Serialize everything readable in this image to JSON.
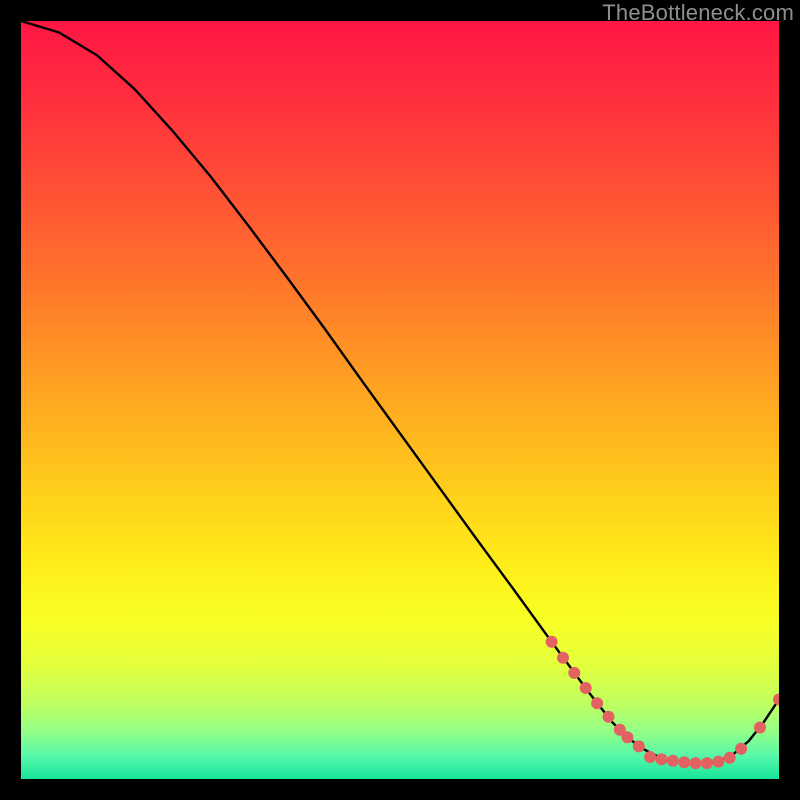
{
  "watermark": "TheBottleneck.com",
  "chart_data": {
    "type": "line",
    "title": "",
    "xlabel": "",
    "ylabel": "",
    "xlim": [
      0,
      100
    ],
    "ylim": [
      0,
      100
    ],
    "series": [
      {
        "name": "curve",
        "x": [
          0,
          5,
          10,
          15,
          20,
          25,
          30,
          35,
          40,
          45,
          50,
          55,
          60,
          65,
          70,
          75,
          78,
          80,
          82,
          84,
          86,
          88,
          90,
          92,
          94,
          96,
          98,
          100
        ],
        "y": [
          100,
          98.5,
          95.5,
          91,
          85.5,
          79.5,
          73,
          66.3,
          59.5,
          52.5,
          45.6,
          38.7,
          31.8,
          25,
          18.1,
          11.3,
          7.5,
          5.5,
          4,
          3,
          2.4,
          2.1,
          2,
          2.3,
          3.3,
          5,
          7.5,
          10.5
        ]
      }
    ],
    "markers": {
      "name": "dots",
      "color": "#e26161",
      "points": [
        {
          "x": 70.0,
          "y": 18.1
        },
        {
          "x": 71.5,
          "y": 16.0
        },
        {
          "x": 73.0,
          "y": 14.0
        },
        {
          "x": 74.5,
          "y": 12.0
        },
        {
          "x": 76.0,
          "y": 10.0
        },
        {
          "x": 77.5,
          "y": 8.2
        },
        {
          "x": 79.0,
          "y": 6.5
        },
        {
          "x": 80.0,
          "y": 5.5
        },
        {
          "x": 81.5,
          "y": 4.3
        },
        {
          "x": 83.0,
          "y": 2.9
        },
        {
          "x": 84.5,
          "y": 2.6
        },
        {
          "x": 86.0,
          "y": 2.4
        },
        {
          "x": 87.5,
          "y": 2.2
        },
        {
          "x": 89.0,
          "y": 2.1
        },
        {
          "x": 90.5,
          "y": 2.1
        },
        {
          "x": 92.0,
          "y": 2.3
        },
        {
          "x": 93.5,
          "y": 2.8
        },
        {
          "x": 95.0,
          "y": 4.0
        },
        {
          "x": 97.5,
          "y": 6.8
        },
        {
          "x": 100.0,
          "y": 10.5
        }
      ]
    },
    "gradient_stops": [
      {
        "offset": 0.0,
        "color": "#ff1744"
      },
      {
        "offset": 0.09,
        "color": "#ff2b3f"
      },
      {
        "offset": 0.18,
        "color": "#ff4438"
      },
      {
        "offset": 0.27,
        "color": "#ff5e31"
      },
      {
        "offset": 0.36,
        "color": "#ff7a2a"
      },
      {
        "offset": 0.45,
        "color": "#ff9824"
      },
      {
        "offset": 0.54,
        "color": "#ffb41f"
      },
      {
        "offset": 0.63,
        "color": "#ffd21b"
      },
      {
        "offset": 0.72,
        "color": "#ffee1a"
      },
      {
        "offset": 0.79,
        "color": "#f8ff23"
      },
      {
        "offset": 0.85,
        "color": "#e3ff3d"
      },
      {
        "offset": 0.9,
        "color": "#c0ff60"
      },
      {
        "offset": 0.94,
        "color": "#8fff89"
      },
      {
        "offset": 0.97,
        "color": "#55f7a9"
      },
      {
        "offset": 1.0,
        "color": "#18e59b"
      }
    ]
  }
}
